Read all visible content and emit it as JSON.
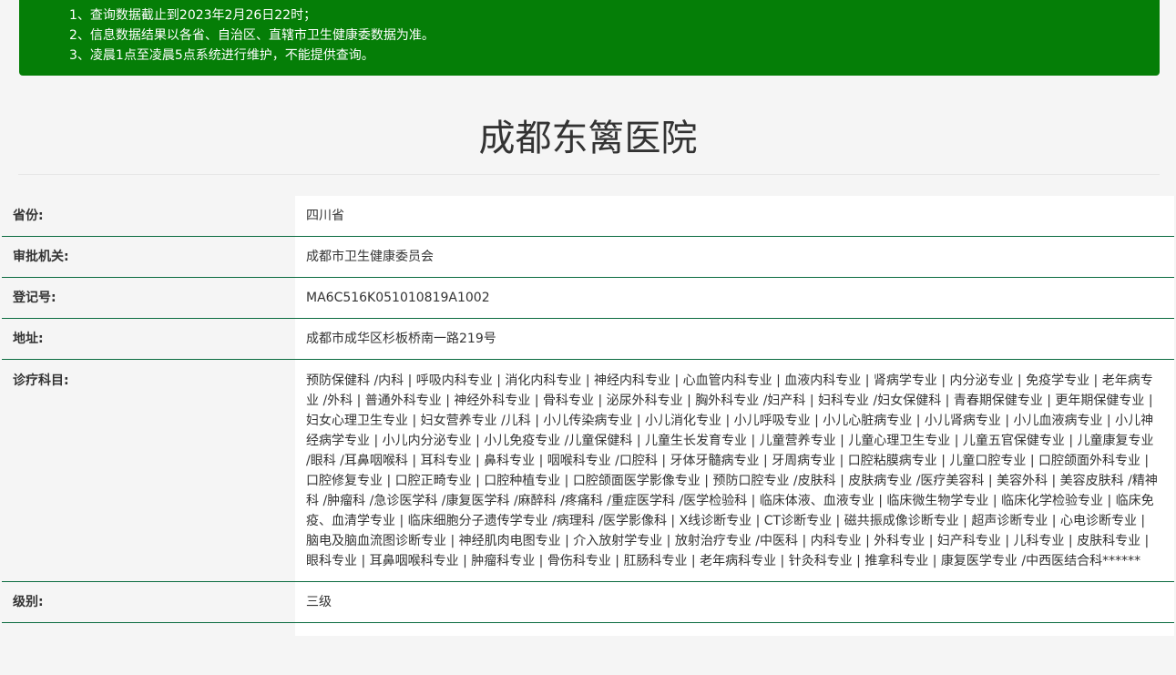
{
  "notice": {
    "lines": [
      "1、查询数据截止到2023年2月26日22时；",
      "2、信息数据结果以各省、自治区、直辖市卫生健康委数据为准。",
      "3、凌晨1点至凌晨5点系统进行维护，不能提供查询。"
    ],
    "bg_color": "#057e07"
  },
  "hospital": {
    "name": "成都东篱医院"
  },
  "fields": {
    "province": {
      "label": "省份:",
      "value": "四川省"
    },
    "authority": {
      "label": "审批机关:",
      "value": "成都市卫生健康委员会"
    },
    "registration": {
      "label": "登记号:",
      "value": "MA6C516K051010819A1002"
    },
    "address": {
      "label": "地址:",
      "value": "成都市成华区杉板桥南一路219号"
    },
    "departments": {
      "label": "诊疗科目:",
      "value": "预防保健科 /内科 | 呼吸内科专业 | 消化内科专业 | 神经内科专业 | 心血管内科专业 | 血液内科专业 | 肾病学专业 | 内分泌专业 | 免疫学专业 | 老年病专业 /外科 | 普通外科专业 | 神经外科专业 | 骨科专业 | 泌尿外科专业 | 胸外科专业 /妇产科 | 妇科专业 /妇女保健科 | 青春期保健专业 | 更年期保健专业 | 妇女心理卫生专业 | 妇女营养专业 /儿科 | 小儿传染病专业 | 小儿消化专业 | 小儿呼吸专业 | 小儿心脏病专业 | 小儿肾病专业 | 小儿血液病专业 | 小儿神经病学专业 | 小儿内分泌专业 | 小儿免疫专业 /儿童保健科 | 儿童生长发育专业 | 儿童营养专业 | 儿童心理卫生专业 | 儿童五官保健专业 | 儿童康复专业 /眼科 /耳鼻咽喉科 | 耳科专业 | 鼻科专业 | 咽喉科专业 /口腔科 | 牙体牙髓病专业 | 牙周病专业 | 口腔粘膜病专业 | 儿童口腔专业 | 口腔颌面外科专业 | 口腔修复专业 | 口腔正畸专业 | 口腔种植专业 | 口腔颌面医学影像专业 | 预防口腔专业 /皮肤科 | 皮肤病专业 /医疗美容科 | 美容外科 | 美容皮肤科 /精神科 /肿瘤科 /急诊医学科 /康复医学科 /麻醉科 /疼痛科 /重症医学科 /医学检验科 | 临床体液、血液专业 | 临床微生物学专业 | 临床化学检验专业 | 临床免疫、血清学专业 | 临床细胞分子遗传学专业 /病理科 /医学影像科 | X线诊断专业 | CT诊断专业 | 磁共振成像诊断专业 | 超声诊断专业 | 心电诊断专业 | 脑电及脑血流图诊断专业 | 神经肌肉电图专业 | 介入放射学专业 | 放射治疗专业 /中医科 | 内科专业 | 外科专业 | 妇产科专业 | 儿科专业 | 皮肤科专业 | 眼科专业 | 耳鼻咽喉科专业 | 肿瘤科专业 | 骨伤科专业 | 肛肠科专业 | 老年病科专业 | 针灸科专业 | 推拿科专业 | 康复医学专业 /中西医结合科******"
    },
    "level": {
      "label": "级别:",
      "value": "三级"
    }
  },
  "colors": {
    "notice_bg": "#057e07",
    "row_border": "#0a6b3f",
    "label_bg": "#f5f5f5",
    "value_bg": "#ffffff"
  }
}
